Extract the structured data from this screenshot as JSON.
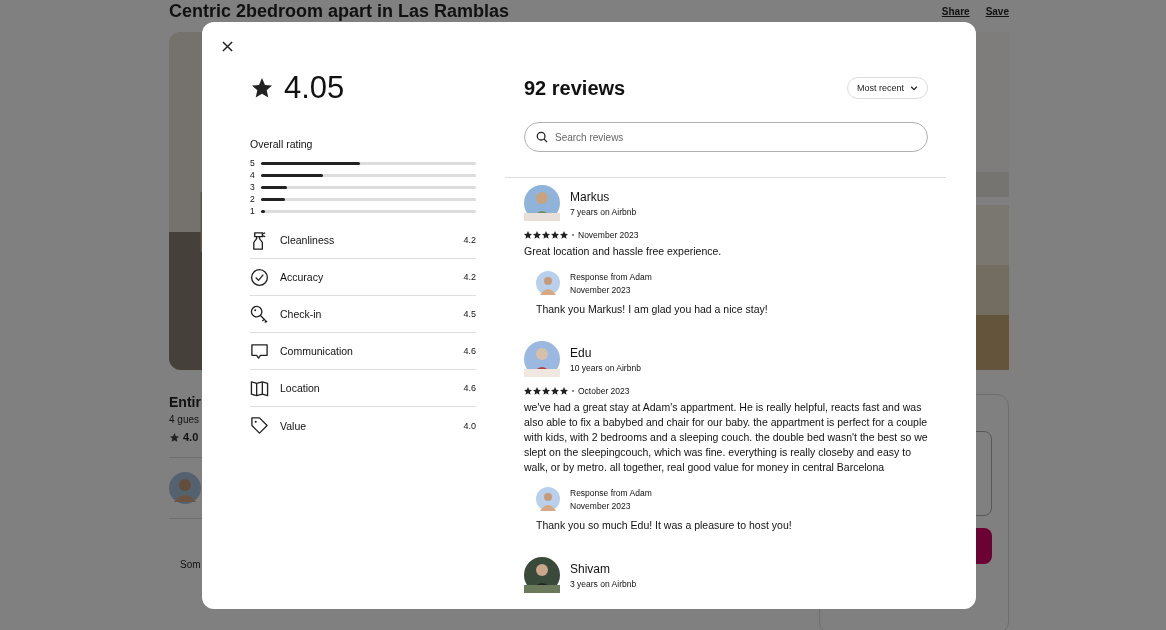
{
  "page": {
    "title": "Centric 2bedroom apart in Las Ramblas",
    "actions": [
      "Share",
      "Save"
    ],
    "listing_title": "Entir",
    "guests": "4 gues",
    "rating": "4.0",
    "section_text": "Som"
  },
  "modal": {
    "rating": "4.05",
    "overall_label": "Overall rating",
    "distribution": [
      {
        "label": "5",
        "level": 0.46
      },
      {
        "label": "4",
        "level": 0.29
      },
      {
        "label": "3",
        "level": 0.12
      },
      {
        "label": "2",
        "level": 0.11
      },
      {
        "label": "1",
        "level": 0.02
      }
    ],
    "categories": [
      {
        "kind": "cleanliness",
        "label": "Cleanliness",
        "score": "4.2"
      },
      {
        "kind": "accuracy",
        "label": "Accuracy",
        "score": "4.2"
      },
      {
        "kind": "checkin",
        "label": "Check-in",
        "score": "4.5"
      },
      {
        "kind": "communication",
        "label": "Communication",
        "score": "4.6"
      },
      {
        "kind": "location",
        "label": "Location",
        "score": "4.6"
      },
      {
        "kind": "value",
        "label": "Value",
        "score": "4.0"
      }
    ],
    "reviews_title": "92 reviews",
    "sort": "Most recent",
    "search": {
      "placeholder": "Search reviews"
    },
    "reviews": [
      {
        "name": "Markus",
        "tenure": "7 years on Airbnb",
        "stars": 5,
        "date": "November 2023",
        "text": "Great location and hassle free experience.",
        "response": {
          "label": "Response from Adam",
          "date": "November 2023",
          "text": "Thank you Markus! I am glad you had a nice stay!"
        }
      },
      {
        "name": "Edu",
        "tenure": "10 years on Airbnb",
        "stars": 5,
        "date": "October 2023",
        "text": "we've had a great stay at Adam's appartment. He is really helpful, reacts fast and was also able to fix a babybed and chair for our baby. the appartment is perfect for a couple with kids, with 2 bedrooms and a sleeping couch. the double bed wasn't the best so we slept on the sleepingcouch, which was fine. everything is really closeby and easy to walk, or by metro. all together, real good value for money in central Barcelona",
        "response": {
          "label": "Response from Adam",
          "date": "November 2023",
          "text": "Thank you so much Edu! It was a pleasure to host you!"
        }
      },
      {
        "name": "Shivam",
        "tenure": "3 years on Airbnb"
      }
    ]
  }
}
